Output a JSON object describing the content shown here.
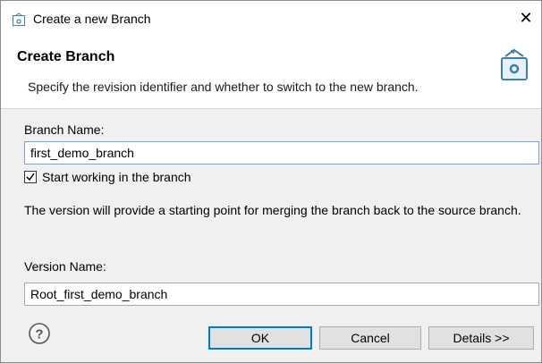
{
  "window": {
    "title": "Create a new Branch",
    "close_glyph": "✕"
  },
  "header": {
    "heading": "Create Branch",
    "description": "Specify the revision identifier and whether to switch to the new branch."
  },
  "form": {
    "branch_name_label": "Branch Name:",
    "branch_name_value": "first_demo_branch",
    "start_working_label": "Start working in the branch",
    "start_working_checked": true,
    "info_text": "The version will provide a starting point for merging the branch back to the source branch.",
    "version_name_label": "Version Name:",
    "version_name_value": "Root_first_demo_branch"
  },
  "footer": {
    "ok_label": "OK",
    "cancel_label": "Cancel",
    "details_label": "Details >>"
  },
  "colors": {
    "accent": "#0078d7",
    "icon_blue": "#3c7fb1"
  },
  "icons": [
    "branch-app-icon",
    "close-icon",
    "branch-banner-icon",
    "checkmark-icon",
    "help-icon"
  ]
}
